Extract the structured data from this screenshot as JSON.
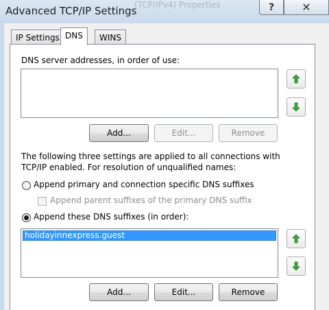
{
  "window": {
    "title": "Advanced TCP/IP Settings",
    "ghost_title": "(TCP/IPv4) Properties",
    "help_glyph": "?",
    "close_glyph": "✕"
  },
  "tabs": [
    {
      "label": "IP Settings",
      "active": false
    },
    {
      "label": "DNS",
      "active": true
    },
    {
      "label": "WINS",
      "active": false
    }
  ],
  "dns_servers": {
    "label": "DNS server addresses, in order of use:",
    "items": [],
    "add_label": "Add...",
    "edit_label": "Edit...",
    "remove_label": "Remove"
  },
  "resolution": {
    "description_line1": "The following three settings are applied to all connections with",
    "description_line2": "TCP/IP enabled. For resolution of unqualified names:",
    "option_primary": "Append primary and connection specific DNS suffixes",
    "option_parent": "Append parent suffixes of the primary DNS suffix",
    "option_these": "Append these DNS suffixes (in order):",
    "selected": "these"
  },
  "dns_suffixes": {
    "items": [
      "holidayinnexpress.guest"
    ],
    "add_label": "Add...",
    "edit_label": "Edit...",
    "remove_label": "Remove"
  },
  "colors": {
    "selection": "#3399ff",
    "arrow_green": "#3aa53a"
  },
  "icons": {
    "up": "arrow-up-icon",
    "down": "arrow-down-icon"
  }
}
